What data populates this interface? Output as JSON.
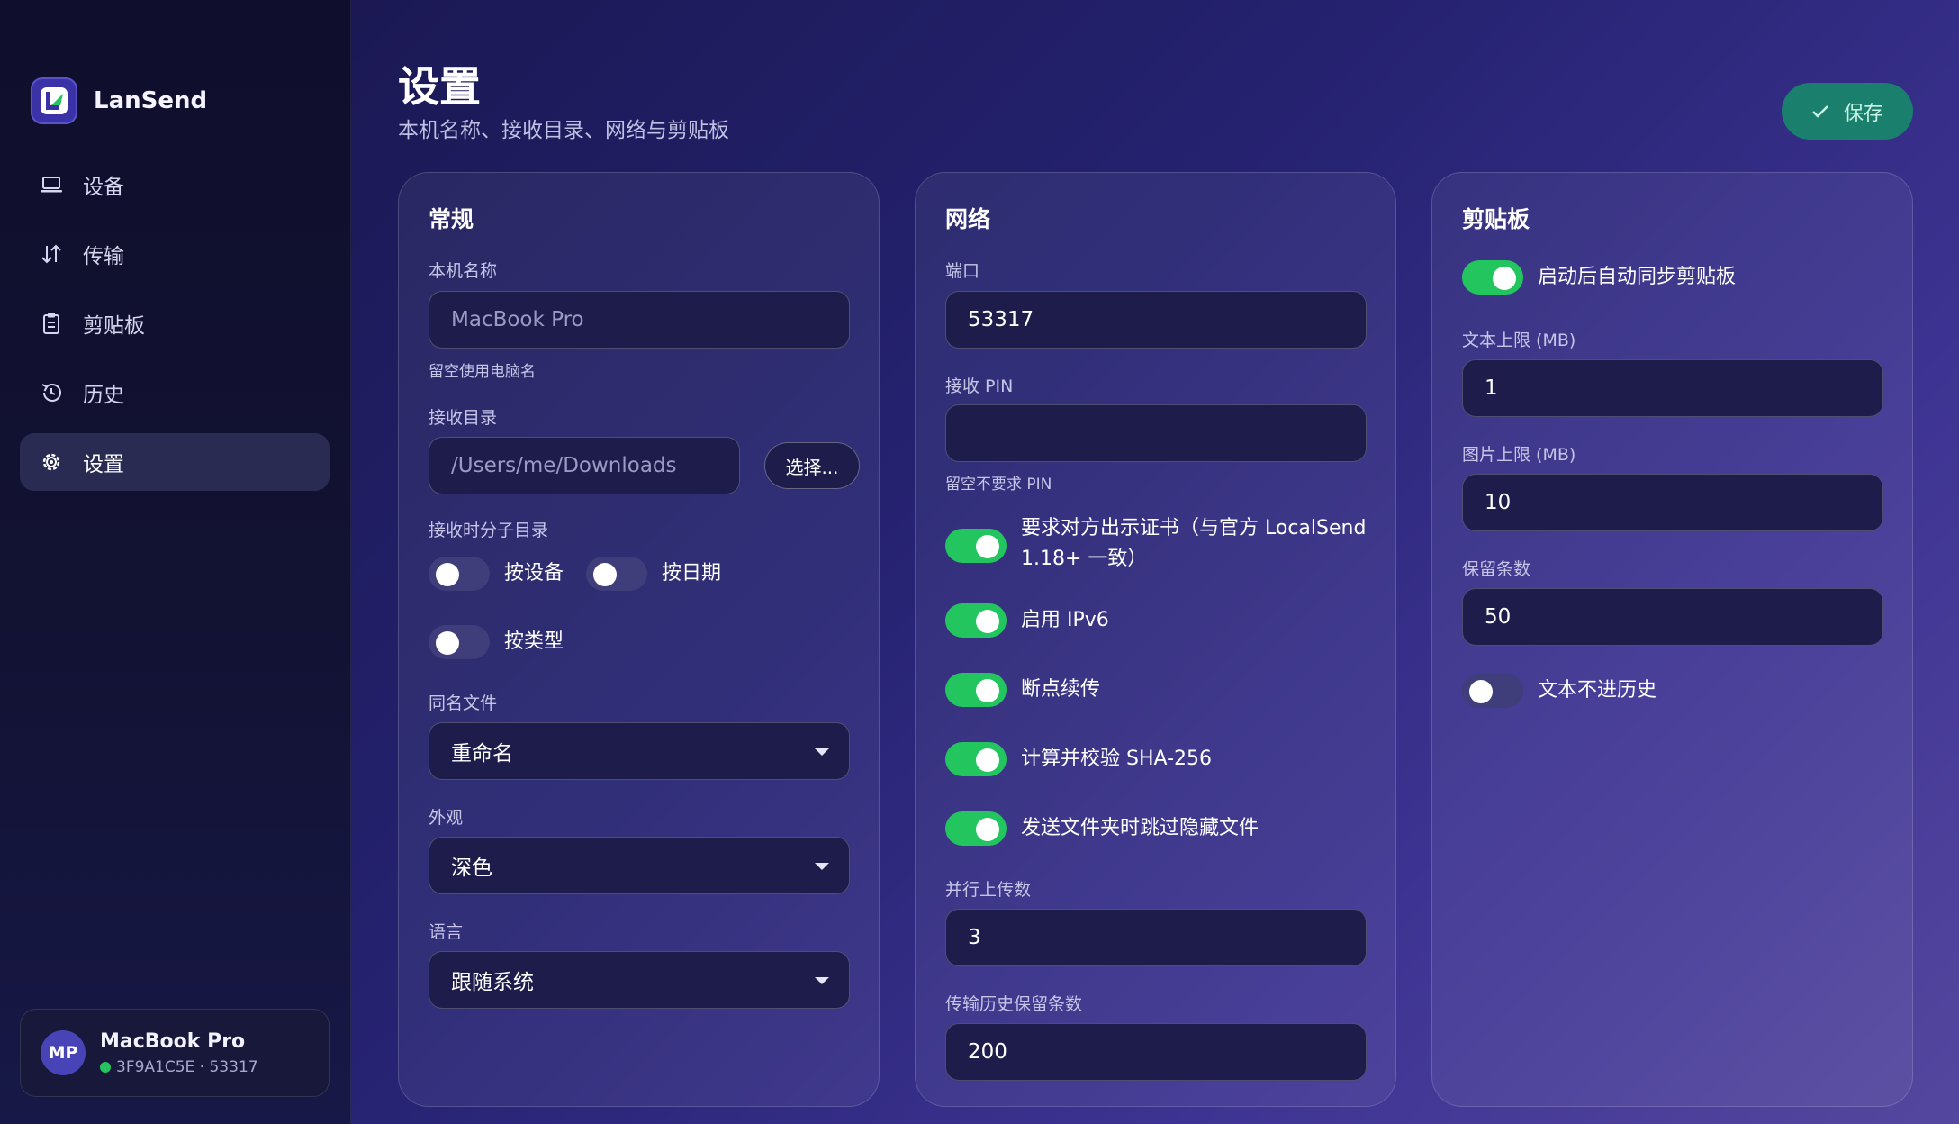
{
  "app": {
    "name": "LanSend"
  },
  "nav": {
    "items": [
      {
        "label": "设备",
        "icon": "laptop-icon"
      },
      {
        "label": "传输",
        "icon": "transfer-arrows-icon"
      },
      {
        "label": "剪贴板",
        "icon": "clipboard-icon"
      },
      {
        "label": "历史",
        "icon": "history-icon"
      },
      {
        "label": "设置",
        "icon": "gear-icon",
        "active": true
      }
    ]
  },
  "device": {
    "avatar": "MP",
    "name": "MacBook Pro",
    "id_port": "3F9A1C5E · 53317",
    "status_color": "#22c55e"
  },
  "header": {
    "title": "设置",
    "subtitle": "本机名称、接收目录、网络与剪贴板",
    "save_label": "保存"
  },
  "general": {
    "title": "常规",
    "device_name": {
      "label": "本机名称",
      "placeholder": "MacBook Pro",
      "hint": "留空使用电脑名"
    },
    "receive_dir": {
      "label": "接收目录",
      "placeholder": "/Users/me/Downloads",
      "choose_label": "选择..."
    },
    "subdir": {
      "label": "接收时分子目录",
      "by_device": {
        "label": "按设备",
        "on": false
      },
      "by_date": {
        "label": "按日期",
        "on": false
      },
      "by_type": {
        "label": "按类型",
        "on": false
      }
    },
    "same_name": {
      "label": "同名文件",
      "value": "重命名"
    },
    "appearance": {
      "label": "外观",
      "value": "深色"
    },
    "language": {
      "label": "语言",
      "value": "跟随系统"
    }
  },
  "network": {
    "title": "网络",
    "port": {
      "label": "端口",
      "value": "53317"
    },
    "pin": {
      "label": "接收 PIN",
      "value": "",
      "hint": "留空不要求 PIN"
    },
    "require_cert": {
      "label_line1": "要求对方出示证书（与官方 LocalSend",
      "label_line2": "1.18+ 一致）",
      "on": true
    },
    "ipv6": {
      "label": "启用 IPv6",
      "on": true
    },
    "resume": {
      "label": "断点续传",
      "on": true
    },
    "sha256": {
      "label": "计算并校验 SHA-256",
      "on": true
    },
    "skip_hidden": {
      "label": "发送文件夹时跳过隐藏文件",
      "on": true
    },
    "parallel": {
      "label": "并行上传数",
      "value": "3"
    },
    "history_keep": {
      "label": "传输历史保留条数",
      "value": "200"
    }
  },
  "clipboard": {
    "title": "剪贴板",
    "auto_sync": {
      "label": "启动后自动同步剪贴板",
      "on": true
    },
    "text_limit": {
      "label": "文本上限 (MB)",
      "value": "1"
    },
    "image_limit": {
      "label": "图片上限 (MB)",
      "value": "10"
    },
    "keep_count": {
      "label": "保留条数",
      "value": "50"
    },
    "text_no_history": {
      "label": "文本不进历史",
      "on": false
    }
  },
  "colors": {
    "accent_green": "#22c55e",
    "save_button": "#1a7f6c",
    "sidebar_active": "#2a2b52"
  }
}
